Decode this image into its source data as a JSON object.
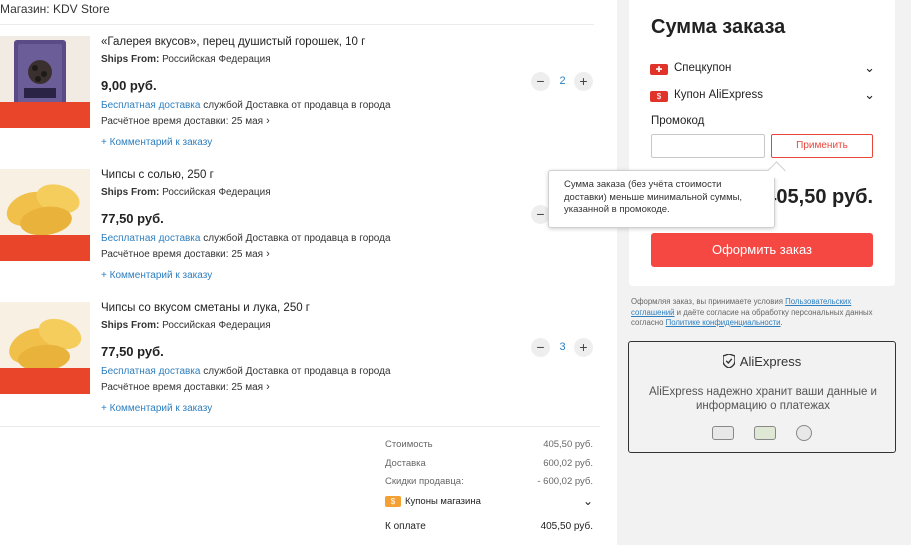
{
  "store": {
    "label": "Магазин: KDV Store"
  },
  "items": [
    {
      "title": "«Галерея вкусов», перец душистый горошек, 10 г",
      "ships_label": "Ships From:",
      "ships_value": "Российская Федерация",
      "price": "9,00 руб.",
      "free_delivery": "Бесплатная доставка",
      "delivery_rest": "службой Доставка от продавца в города",
      "eta": "Расчётное время доставки: 25 мая",
      "comment": "+ Комментарий к заказу",
      "qty": "2",
      "image": "spice-packet"
    },
    {
      "title": "Чипсы с солью, 250 г",
      "ships_label": "Ships From:",
      "ships_value": "Российская Федерация",
      "price": "77,50 руб.",
      "free_delivery": "Бесплатная доставка",
      "delivery_rest": "службой Доставка от продавца в города",
      "eta": "Расчётное время доставки: 25 мая",
      "comment": "+ Комментарий к заказу",
      "qty": "",
      "image": "chips"
    },
    {
      "title": "Чипсы со вкусом сметаны и лука, 250 г",
      "ships_label": "Ships From:",
      "ships_value": "Российская Федерация",
      "price": "77,50 руб.",
      "free_delivery": "Бесплатная доставка",
      "delivery_rest": "службой Доставка от продавца в города",
      "eta": "Расчётное время доставки: 25 мая",
      "comment": "+ Комментарий к заказу",
      "qty": "3",
      "image": "chips"
    }
  ],
  "summary": {
    "cost_label": "Стоимость",
    "cost_value": "405,50 руб.",
    "delivery_label": "Доставка",
    "delivery_value": "600,02 руб.",
    "discount_label": "Скидки продавца:",
    "discount_value": "- 600,02 руб.",
    "coupons_label": "Купоны магазина",
    "pay_label": "К оплате",
    "pay_value": "405,50 руб."
  },
  "order": {
    "title": "Сумма заказа",
    "special_coupon": "Спецкупон",
    "aliexpress_coupon": "Купон AliExpress",
    "promo_label": "Промокод",
    "promo_placeholder": "",
    "apply_button": "Применить",
    "total": "405,50 руб.",
    "submit_button": "Оформить заказ"
  },
  "tooltip": {
    "text": "Сумма заказа (без учёта стоимости доставки) меньше минимальной суммы, указанной в промокоде."
  },
  "legal": {
    "part1": "Оформляя заказ, вы принимаете условия ",
    "link1": "Пользовательских соглашений",
    "part2": " и даёте согласие на обработку персональных данных согласно ",
    "link2": "Политике конфиденциальности",
    "part3": "."
  },
  "secure": {
    "brand": "AliExpress",
    "text": "AliExpress надежно хранит ваши данные и информацию о платежах"
  },
  "colors": {
    "accent": "#f64843",
    "link": "#2e7fbf",
    "panel_bg": "#f2f2f2"
  }
}
